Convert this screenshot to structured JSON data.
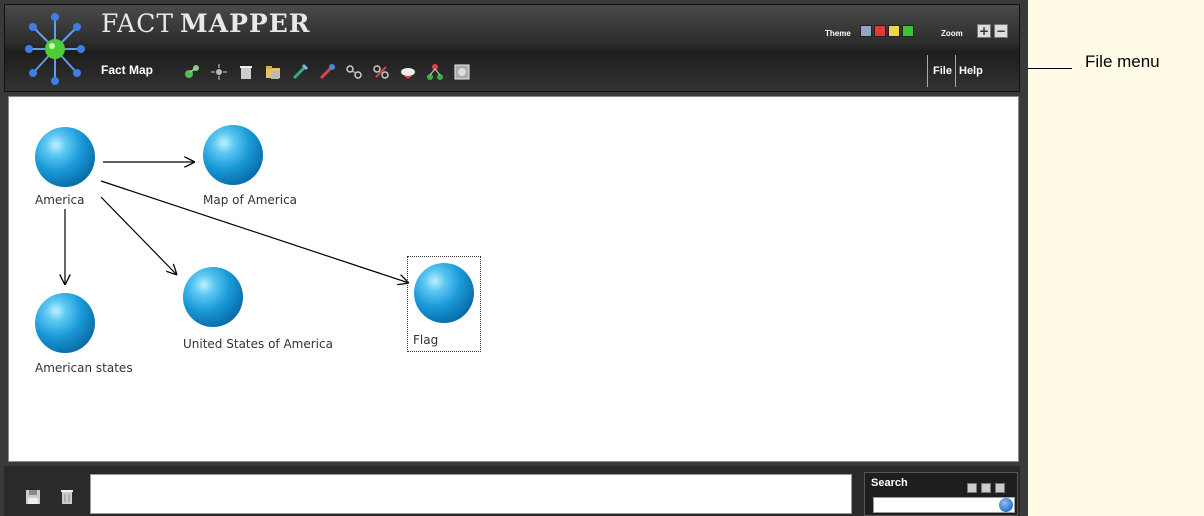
{
  "header": {
    "title_part1": "FACT",
    "title_part2": "MAPPER",
    "map_name": "Fact Map",
    "theme_label": "Theme",
    "zoom_label": "Zoom",
    "theme_colors": [
      "#8ea6c8",
      "#e03a3a",
      "#e8d84a",
      "#3cc33c"
    ],
    "menu": {
      "file": "File",
      "help": "Help"
    },
    "toolbar_icons": [
      "add-fact-icon",
      "magic-icon",
      "delete-icon",
      "folder-icon",
      "edit-icon",
      "pin-icon",
      "link-icon",
      "unlink-icon",
      "cloud-icon",
      "layout-icon",
      "image-icon"
    ]
  },
  "canvas": {
    "nodes": [
      {
        "id": "america",
        "label": "America"
      },
      {
        "id": "map",
        "label": "Map of America"
      },
      {
        "id": "states",
        "label": "American states"
      },
      {
        "id": "usa",
        "label": "United States of America"
      },
      {
        "id": "flag",
        "label": "Flag",
        "selected": true
      }
    ],
    "edges": [
      {
        "from": "america",
        "to": "map"
      },
      {
        "from": "america",
        "to": "states"
      },
      {
        "from": "america",
        "to": "usa"
      },
      {
        "from": "america",
        "to": "flag"
      }
    ]
  },
  "bottom": {
    "icons": [
      "save-icon",
      "trash-icon"
    ],
    "note_value": "",
    "search_label": "Search",
    "search_value": ""
  },
  "annotation": {
    "text": "File menu"
  }
}
